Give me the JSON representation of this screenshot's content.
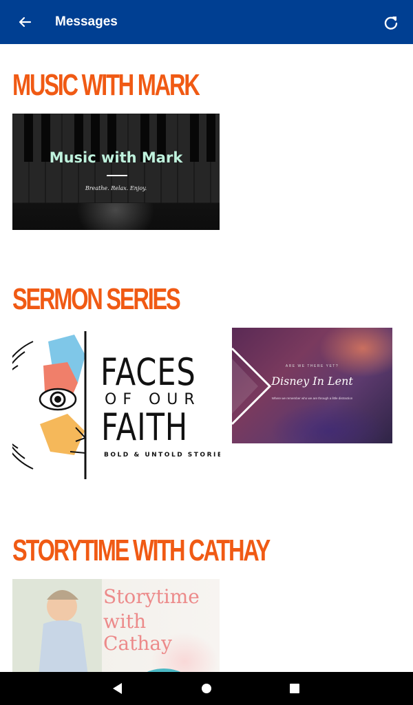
{
  "appbar": {
    "title": "Messages",
    "color": "#003f92",
    "back_icon": "arrow-left-icon",
    "refresh_icon": "refresh-icon"
  },
  "accent_color": "#f05a14",
  "sections": [
    {
      "heading": "MUSIC WITH MARK",
      "items": [
        {
          "title": "Music with Mark",
          "subtitle": "Breathe. Relax. Enjoy."
        }
      ]
    },
    {
      "heading": "SERMON SERIES",
      "items": [
        {
          "line1": "FACES",
          "line2": "OF OUR",
          "line3": "FAITH",
          "tagline": "BOLD & UNTOLD STORIES"
        },
        {
          "small": "ARE WE THERE YET?",
          "title": "Disney In Lent",
          "subtitle": "Where we remember who we are through a little distraction"
        }
      ]
    },
    {
      "heading": "STORYTIME WITH CATHAY",
      "items": [
        {
          "line1": "Storytime",
          "line2": "with",
          "line3": "Cathay"
        }
      ]
    }
  ],
  "navbar": {
    "back_icon": "triangle-back-icon",
    "home_icon": "circle-home-icon",
    "recents_icon": "square-recents-icon"
  }
}
